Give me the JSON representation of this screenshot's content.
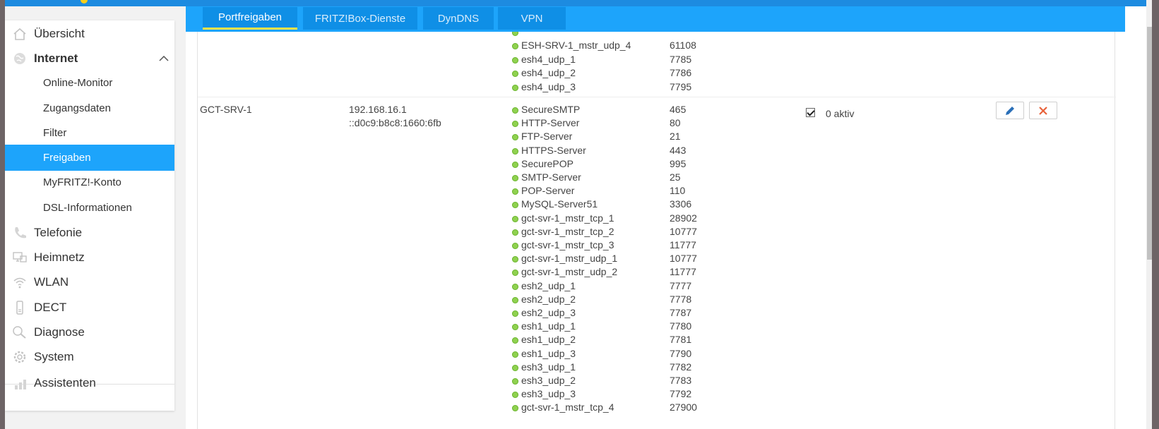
{
  "sidebar": {
    "items": [
      {
        "label": "Übersicht",
        "icon": "home-icon"
      },
      {
        "label": "Internet",
        "icon": "globe-icon"
      },
      {
        "label": "Online-Monitor"
      },
      {
        "label": "Zugangsdaten"
      },
      {
        "label": "Filter"
      },
      {
        "label": "Freigaben"
      },
      {
        "label": "MyFRITZ!-Konto"
      },
      {
        "label": "DSL-Informationen"
      },
      {
        "label": "Telefonie",
        "icon": "phone-icon"
      },
      {
        "label": "Heimnetz",
        "icon": "network-icon"
      },
      {
        "label": "WLAN",
        "icon": "wifi-icon"
      },
      {
        "label": "DECT",
        "icon": "dect-phone-icon"
      },
      {
        "label": "Diagnose",
        "icon": "diagnose-icon"
      },
      {
        "label": "System",
        "icon": "system-icon"
      },
      {
        "label": "Assistenten",
        "icon": "assistant-icon"
      }
    ],
    "active": "Freigaben"
  },
  "tabs": [
    {
      "label": "Portfreigaben",
      "active": true
    },
    {
      "label": "FRITZ!Box-Dienste",
      "active": false
    },
    {
      "label": "DynDNS",
      "active": false
    },
    {
      "label": "VPN",
      "active": false
    }
  ],
  "prev_device": {
    "rules": [
      {
        "name": "ESH-SRV-1_mstr_udp_4",
        "port": "61108"
      },
      {
        "name": "esh4_udp_1",
        "port": "7785"
      },
      {
        "name": "esh4_udp_2",
        "port": "7786"
      },
      {
        "name": "esh4_udp_3",
        "port": "7795"
      }
    ]
  },
  "device": {
    "name": "GCT-SRV-1",
    "ipv4": "192.168.16.1",
    "ipv6": "::d0c9:b8c8:1660:6fb",
    "active_label": "0 aktiv",
    "rules": [
      {
        "name": "SecureSMTP",
        "port": "465"
      },
      {
        "name": "HTTP-Server",
        "port": "80"
      },
      {
        "name": "FTP-Server",
        "port": "21"
      },
      {
        "name": "HTTPS-Server",
        "port": "443"
      },
      {
        "name": "SecurePOP",
        "port": "995"
      },
      {
        "name": "SMTP-Server",
        "port": "25"
      },
      {
        "name": "POP-Server",
        "port": "110"
      },
      {
        "name": "MySQL-Server51",
        "port": "3306"
      },
      {
        "name": "gct-svr-1_mstr_tcp_1",
        "port": "28902"
      },
      {
        "name": "gct-svr-1_mstr_tcp_2",
        "port": "10777"
      },
      {
        "name": "gct-svr-1_mstr_tcp_3",
        "port": "11777"
      },
      {
        "name": "gct-svr-1_mstr_udp_1",
        "port": "10777"
      },
      {
        "name": "gct-svr-1_mstr_udp_2",
        "port": "11777"
      },
      {
        "name": "esh2_udp_1",
        "port": "7777"
      },
      {
        "name": "esh2_udp_2",
        "port": "7778"
      },
      {
        "name": "esh2_udp_3",
        "port": "7787"
      },
      {
        "name": "esh1_udp_1",
        "port": "7780"
      },
      {
        "name": "esh1_udp_2",
        "port": "7781"
      },
      {
        "name": "esh1_udp_3",
        "port": "7790"
      },
      {
        "name": "esh3_udp_1",
        "port": "7782"
      },
      {
        "name": "esh3_udp_2",
        "port": "7783"
      },
      {
        "name": "esh3_udp_3",
        "port": "7792"
      },
      {
        "name": "gct-svr-1_mstr_tcp_4",
        "port": "27900"
      }
    ]
  },
  "colors": {
    "accent": "#1da4fb",
    "active_tab_underline": "#fbe34b",
    "status_dot": "#8fd14f",
    "delete": "#e8623a",
    "edit": "#2a6fb8"
  }
}
